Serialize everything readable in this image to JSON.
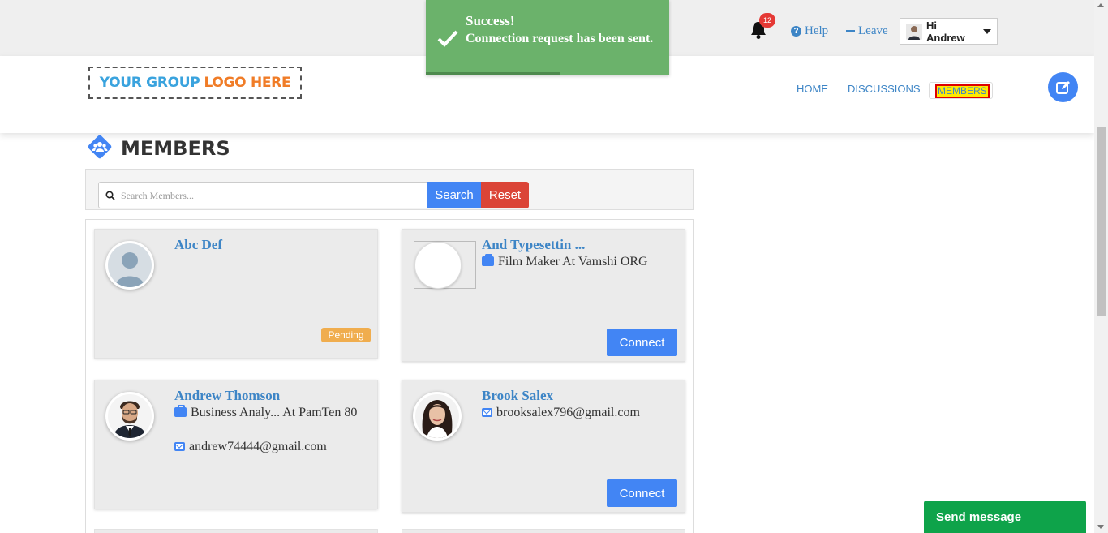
{
  "topbar": {
    "notification_count": "12",
    "help_label": "Help",
    "leave_label": "Leave",
    "user_greeting": "Hi Andrew"
  },
  "toast": {
    "title": "Success!",
    "message": "Connection request has been sent.",
    "color": "#6bb26b"
  },
  "header": {
    "logo_part1": "YOUR GROUP",
    "logo_part2": "LOGO HERE",
    "nav": {
      "home": "HOME",
      "discussions": "DISCUSSIONS",
      "members": "MEMBERS"
    }
  },
  "page": {
    "title": "MEMBERS"
  },
  "search": {
    "placeholder": "Search Members...",
    "search_label": "Search",
    "reset_label": "Reset"
  },
  "members": [
    {
      "name": "Abc Def",
      "status": "Pending"
    },
    {
      "name": "And Typesettin ...",
      "job": "Film Maker At Vamshi ORG",
      "action": "Connect"
    },
    {
      "name": "Andrew Thomson",
      "job": "Business Analy... At PamTen 80",
      "email": "andrew74444@gmail.com"
    },
    {
      "name": "Brook Salex",
      "email": "brooksalex796@gmail.com",
      "action": "Connect"
    }
  ],
  "chat": {
    "label": "Send message"
  },
  "colors": {
    "primary": "#4285f4",
    "danger": "#db4437",
    "link": "#3d85c6",
    "pending": "#f0ad4e",
    "chat": "#0ea34a"
  }
}
